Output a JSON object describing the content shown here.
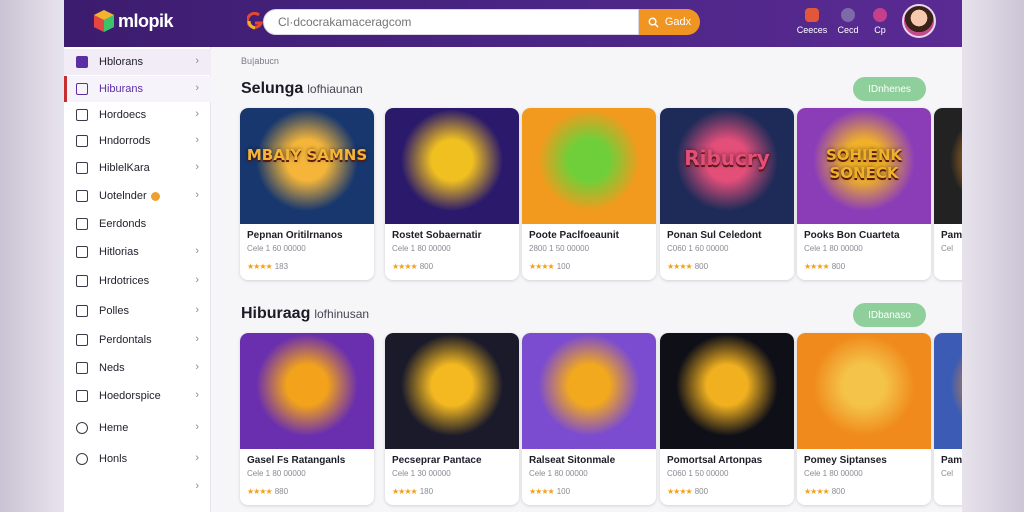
{
  "app": {
    "brand": "mlopik"
  },
  "search": {
    "placeholder": "Cl·dcocrakamaceragcom",
    "button_label": "Gadx"
  },
  "header_actions": [
    {
      "label": "Ceeces",
      "icon": "notification-icon",
      "color": "#e2573a"
    },
    {
      "label": "Cecd",
      "icon": "messages-icon",
      "color": "#7d6aa8"
    },
    {
      "label": "Cp",
      "icon": "favorites-icon",
      "color": "#c63f8c"
    }
  ],
  "sidebar": {
    "items": [
      {
        "label": "Hblorans",
        "icon": "home-icon"
      },
      {
        "label": "Hiburans",
        "icon": "entertainment-icon"
      },
      {
        "label": "Hordoecs",
        "icon": "collection-icon"
      },
      {
        "label": "Hndorrods",
        "icon": "bookmark-icon"
      },
      {
        "label": "HiblelKara",
        "icon": "list-icon"
      },
      {
        "label": "Uotelnder",
        "icon": "calendar-icon",
        "badge": true
      },
      {
        "label": "Eerdonds",
        "icon": "document-icon"
      },
      {
        "label": "Hitlorias",
        "icon": "grid-icon"
      },
      {
        "label": "Hrdotrices",
        "icon": "chart-icon"
      },
      {
        "label": "Polles",
        "icon": "tag-icon"
      },
      {
        "label": "Perdontals",
        "icon": "table-icon"
      },
      {
        "label": "Neds",
        "icon": "flag-icon"
      },
      {
        "label": "Hoedorspice",
        "icon": "gallery-icon"
      },
      {
        "label": "Heme",
        "icon": "globe-icon"
      },
      {
        "label": "Honls",
        "icon": "settings-icon"
      },
      {
        "label": "",
        "icon": ""
      }
    ]
  },
  "breadcrumb": "Bu|abucn",
  "sections": [
    {
      "title": "Selunga",
      "subtitle": "lofhiaunan",
      "pill": "IDnhenes",
      "cards": [
        {
          "thumb_text": "MBAIY SAMNS",
          "title": "Pepnan Oritilrnanos",
          "meta": "Cele  1 60 00000",
          "rating": "183",
          "bg": "#17376e",
          "accent": "#f4b53a"
        },
        {
          "thumb_text": "",
          "title": "Rostet Sobaernatir",
          "meta": "Cele  1 80 00000",
          "rating": "800",
          "bg": "#2b1a6b",
          "accent": "#f0c020"
        },
        {
          "thumb_text": "",
          "title": "Poote Paclfoeaunit",
          "meta": "2800  1 50 00000",
          "rating": "100",
          "bg": "#f29a1d",
          "accent": "#6fcf3a"
        },
        {
          "thumb_text": "Ribucry",
          "title": "Ponan Sul Celedont",
          "meta": "C060  1 60 00000",
          "rating": "800",
          "bg": "#1e2b58",
          "accent": "#e44f7a"
        },
        {
          "thumb_text": "SOHIENK SONECK",
          "title": "Pooks Bon Cuarteta",
          "meta": "Cele  1 80 00000",
          "rating": "800",
          "bg": "#8b3db8",
          "accent": "#f0b02a"
        },
        {
          "thumb_text": "",
          "title": "Pam",
          "meta": "Cel",
          "rating": "",
          "bg": "#222",
          "accent": "#f09020"
        }
      ]
    },
    {
      "title": "Hiburaag",
      "subtitle": "lofhinusan",
      "pill": "IDbanaso",
      "cards": [
        {
          "thumb_text": "",
          "title": "Gasel Fs Ratanganls",
          "meta": "Cele  1 80 00000",
          "rating": "880",
          "bg": "#6a2fae",
          "accent": "#f2a31b"
        },
        {
          "thumb_text": "",
          "title": "Pecseprar Pantace",
          "meta": "Cele  1 30 00000",
          "rating": "180",
          "bg": "#1a1a2a",
          "accent": "#f4b921"
        },
        {
          "thumb_text": "",
          "title": "Ralseat Sitonmale",
          "meta": "Cele  1 80 00000",
          "rating": "100",
          "bg": "#7b4bd0",
          "accent": "#f2a91e"
        },
        {
          "thumb_text": "",
          "title": "Pomortsal Artonpas",
          "meta": "C060  1 50 00000",
          "rating": "800",
          "bg": "#0f0f18",
          "accent": "#f0b020"
        },
        {
          "thumb_text": "",
          "title": "Pomey Siptanses",
          "meta": "Cele  1 80 00000",
          "rating": "800",
          "bg": "#f08a1c",
          "accent": "#f4c44a"
        },
        {
          "thumb_text": "",
          "title": "Pam",
          "meta": "Cel",
          "rating": "",
          "bg": "#3b5bb5",
          "accent": "#f09020"
        }
      ]
    }
  ]
}
